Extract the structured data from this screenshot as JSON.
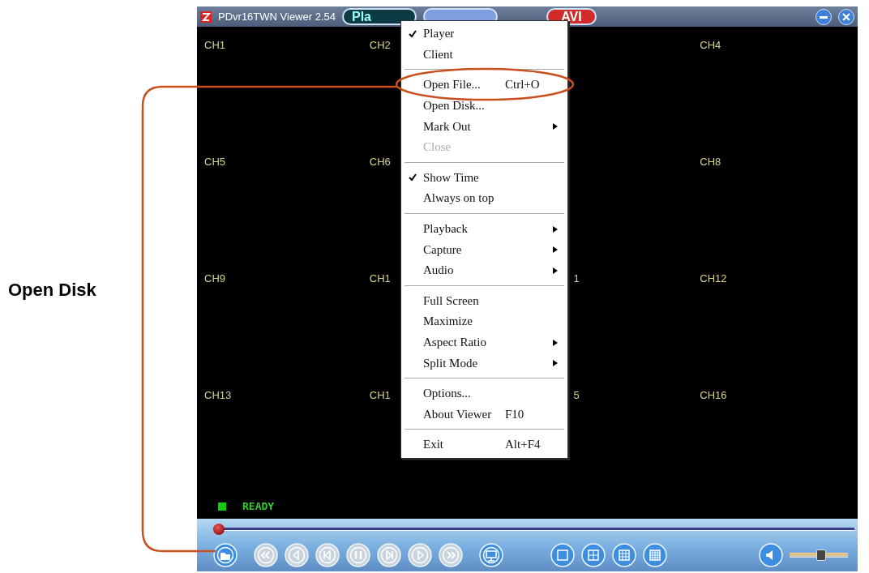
{
  "annotation": {
    "label": "Open Disk"
  },
  "window": {
    "title": "PDvr16TWN Viewer 2.54",
    "title_buttons": [
      {
        "label": "Pla",
        "kind": "teal"
      },
      {
        "kind": "violet"
      },
      {
        "label": "AVI",
        "kind": "red"
      }
    ]
  },
  "channels": [
    {
      "label": "CH1"
    },
    {
      "label": "CH2"
    },
    {
      "label": "CH4"
    },
    {
      "label": "CH5"
    },
    {
      "label": "CH6"
    },
    {
      "label": "CH8"
    },
    {
      "label": "CH9"
    },
    {
      "label": "CH1"
    },
    {
      "label": "1"
    },
    {
      "label": "CH12"
    },
    {
      "label": "CH13"
    },
    {
      "label": "CH1"
    },
    {
      "label": "5"
    },
    {
      "label": "CH16"
    }
  ],
  "menu": [
    {
      "kind": "item",
      "label": "Player",
      "checked": true,
      "submenu": false,
      "disabled": false
    },
    {
      "kind": "item",
      "label": "Client",
      "checked": false,
      "submenu": false,
      "disabled": false
    },
    {
      "kind": "separator"
    },
    {
      "kind": "item",
      "label": "Open File...",
      "shortcut": "Ctrl+O",
      "checked": false,
      "submenu": false,
      "disabled": false
    },
    {
      "kind": "item",
      "label": "Open Disk...",
      "checked": false,
      "submenu": false,
      "disabled": false
    },
    {
      "kind": "item",
      "label": "Mark Out",
      "checked": false,
      "submenu": true,
      "disabled": false
    },
    {
      "kind": "item",
      "label": "Close",
      "checked": false,
      "submenu": false,
      "disabled": true
    },
    {
      "kind": "separator"
    },
    {
      "kind": "item",
      "label": "Show Time",
      "checked": true,
      "submenu": false,
      "disabled": false
    },
    {
      "kind": "item",
      "label": "Always on top",
      "checked": false,
      "submenu": false,
      "disabled": false
    },
    {
      "kind": "separator"
    },
    {
      "kind": "item",
      "label": "Playback",
      "checked": false,
      "submenu": true,
      "disabled": false
    },
    {
      "kind": "item",
      "label": "Capture",
      "checked": false,
      "submenu": true,
      "disabled": false
    },
    {
      "kind": "item",
      "label": "Audio",
      "checked": false,
      "submenu": true,
      "disabled": false
    },
    {
      "kind": "separator"
    },
    {
      "kind": "item",
      "label": "Full Screen",
      "checked": false,
      "submenu": false,
      "disabled": false
    },
    {
      "kind": "item",
      "label": "Maximize",
      "checked": false,
      "submenu": false,
      "disabled": false
    },
    {
      "kind": "item",
      "label": "Aspect Ratio",
      "checked": false,
      "submenu": true,
      "disabled": false
    },
    {
      "kind": "item",
      "label": "Split Mode",
      "checked": false,
      "submenu": true,
      "disabled": false
    },
    {
      "kind": "separator"
    },
    {
      "kind": "item",
      "label": "Options...",
      "checked": false,
      "submenu": false,
      "disabled": false
    },
    {
      "kind": "item",
      "label": "About Viewer",
      "shortcut": "F10",
      "checked": false,
      "submenu": false,
      "disabled": false
    },
    {
      "kind": "separator"
    },
    {
      "kind": "item",
      "label": "Exit",
      "shortcut": "Alt+F4",
      "checked": false,
      "submenu": false,
      "disabled": false
    }
  ],
  "status": {
    "text": "READY"
  },
  "progress": {
    "level": 0
  },
  "volume": {
    "level": 0.55
  }
}
